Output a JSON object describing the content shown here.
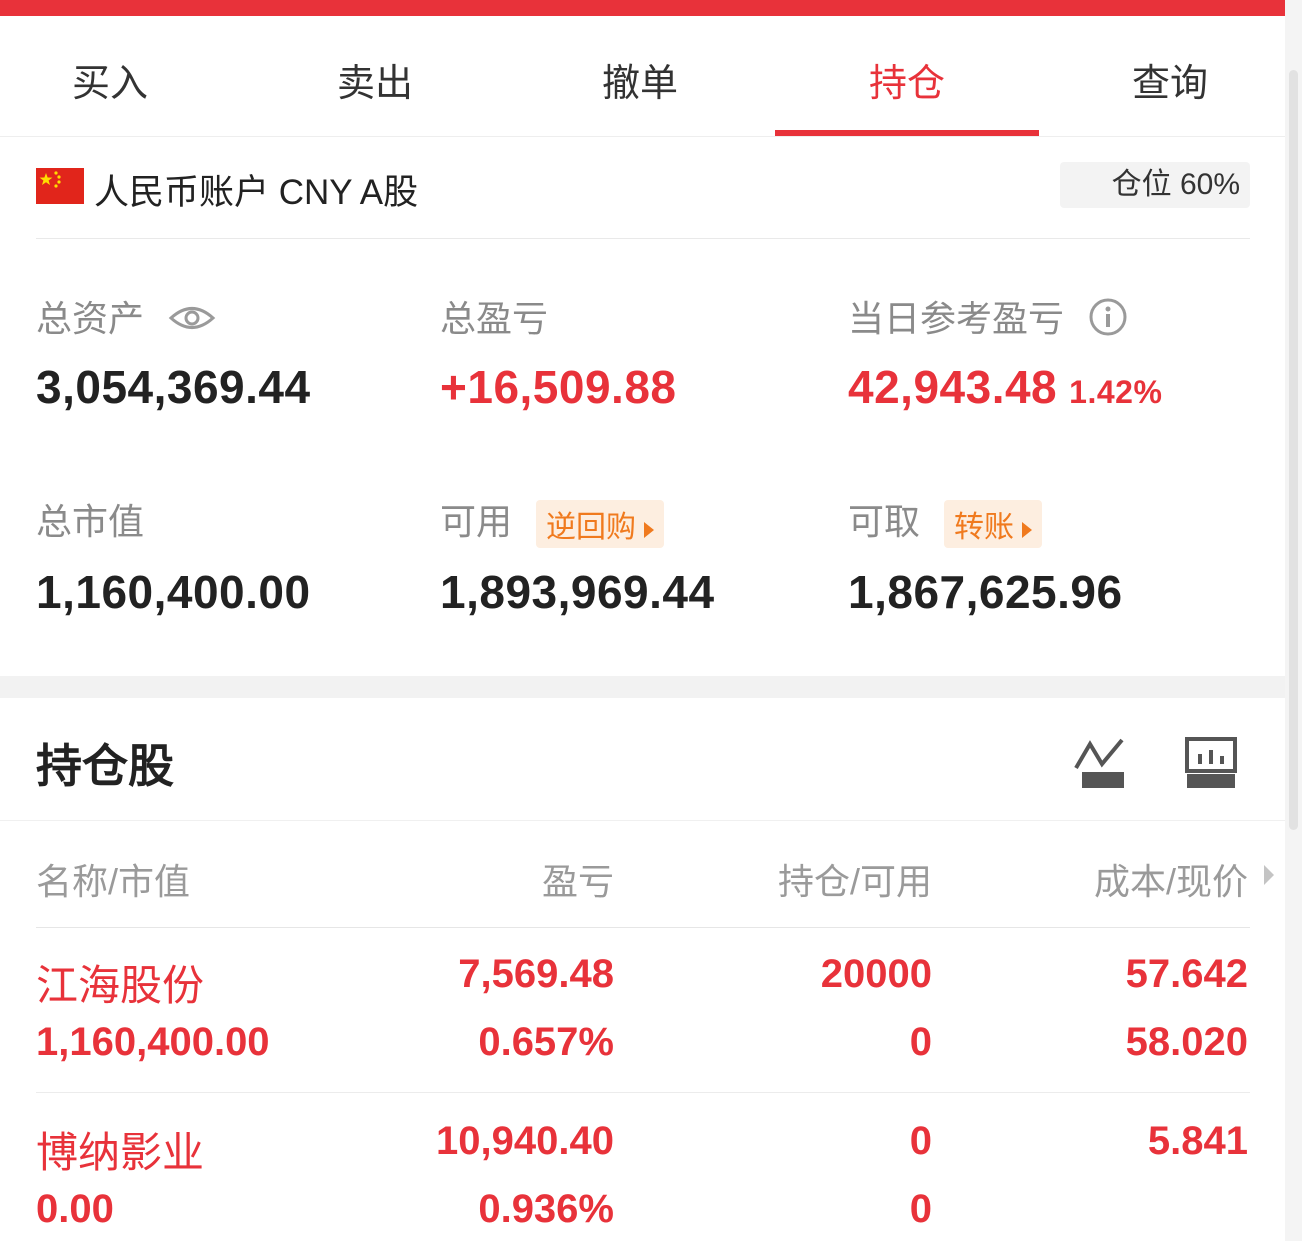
{
  "tabs": [
    {
      "label": "买入"
    },
    {
      "label": "卖出"
    },
    {
      "label": "撤单"
    },
    {
      "label": "持仓"
    },
    {
      "label": "查询"
    }
  ],
  "account": {
    "label": "人民币账户 CNY A股",
    "position_pct": "仓位 60%"
  },
  "stats": {
    "total_assets": {
      "label": "总资产",
      "value": "3,054,369.44"
    },
    "total_pnl": {
      "label": "总盈亏",
      "value": "+16,509.88"
    },
    "today_pnl": {
      "label": "当日参考盈亏",
      "value": "42,943.48",
      "pct": "1.42%"
    },
    "market_value": {
      "label": "总市值",
      "value": "1,160,400.00"
    },
    "available": {
      "label": "可用",
      "tag": "逆回购",
      "value": "1,893,969.44"
    },
    "withdrawable": {
      "label": "可取",
      "tag": "转账",
      "value": "1,867,625.96"
    }
  },
  "holdings": {
    "title": "持仓股",
    "columns": [
      "名称/市值",
      "盈亏",
      "持仓/可用",
      "成本/现价"
    ],
    "rows": [
      {
        "name": "江海股份",
        "market_value": "1,160,400.00",
        "pnl": "7,569.48",
        "pnl_pct": "0.657%",
        "position": "20000",
        "available": "0",
        "cost": "57.642",
        "price": "58.020"
      },
      {
        "name": "博纳影业",
        "market_value": "0.00",
        "pnl": "10,940.40",
        "pnl_pct": "0.936%",
        "position": "0",
        "available": "0",
        "cost": "5.841",
        "price": ""
      }
    ]
  },
  "colors": {
    "accent": "#e8323a",
    "tag_orange": "#f07a1e",
    "muted": "#8a8a8a"
  }
}
